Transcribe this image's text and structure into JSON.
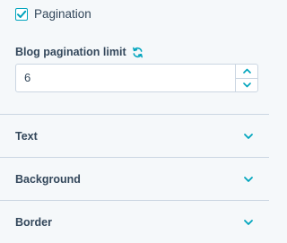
{
  "pagination": {
    "label": "Pagination",
    "checked": true
  },
  "limit_field": {
    "label": "Blog pagination limit",
    "icon": "refresh-icon",
    "value": "6"
  },
  "sections": [
    {
      "title": "Text",
      "icon": "chevron-down-icon"
    },
    {
      "title": "Background",
      "icon": "chevron-down-icon"
    },
    {
      "title": "Border",
      "icon": "chevron-down-icon"
    }
  ],
  "colors": {
    "accent": "#00a4bd",
    "text": "#33475b",
    "border": "#cbd6e2",
    "background": "#f5f8fa"
  }
}
